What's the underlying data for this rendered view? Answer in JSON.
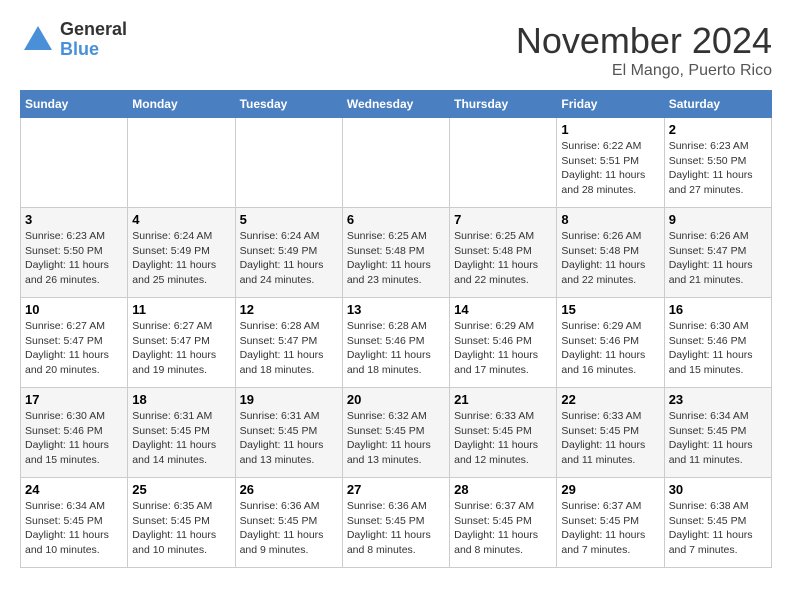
{
  "logo": {
    "general": "General",
    "blue": "Blue"
  },
  "title": {
    "month": "November 2024",
    "location": "El Mango, Puerto Rico"
  },
  "weekdays": [
    "Sunday",
    "Monday",
    "Tuesday",
    "Wednesday",
    "Thursday",
    "Friday",
    "Saturday"
  ],
  "weeks": [
    [
      {
        "day": "",
        "sunrise": "",
        "sunset": "",
        "daylight": ""
      },
      {
        "day": "",
        "sunrise": "",
        "sunset": "",
        "daylight": ""
      },
      {
        "day": "",
        "sunrise": "",
        "sunset": "",
        "daylight": ""
      },
      {
        "day": "",
        "sunrise": "",
        "sunset": "",
        "daylight": ""
      },
      {
        "day": "",
        "sunrise": "",
        "sunset": "",
        "daylight": ""
      },
      {
        "day": "1",
        "sunrise": "Sunrise: 6:22 AM",
        "sunset": "Sunset: 5:51 PM",
        "daylight": "Daylight: 11 hours and 28 minutes."
      },
      {
        "day": "2",
        "sunrise": "Sunrise: 6:23 AM",
        "sunset": "Sunset: 5:50 PM",
        "daylight": "Daylight: 11 hours and 27 minutes."
      }
    ],
    [
      {
        "day": "3",
        "sunrise": "Sunrise: 6:23 AM",
        "sunset": "Sunset: 5:50 PM",
        "daylight": "Daylight: 11 hours and 26 minutes."
      },
      {
        "day": "4",
        "sunrise": "Sunrise: 6:24 AM",
        "sunset": "Sunset: 5:49 PM",
        "daylight": "Daylight: 11 hours and 25 minutes."
      },
      {
        "day": "5",
        "sunrise": "Sunrise: 6:24 AM",
        "sunset": "Sunset: 5:49 PM",
        "daylight": "Daylight: 11 hours and 24 minutes."
      },
      {
        "day": "6",
        "sunrise": "Sunrise: 6:25 AM",
        "sunset": "Sunset: 5:48 PM",
        "daylight": "Daylight: 11 hours and 23 minutes."
      },
      {
        "day": "7",
        "sunrise": "Sunrise: 6:25 AM",
        "sunset": "Sunset: 5:48 PM",
        "daylight": "Daylight: 11 hours and 22 minutes."
      },
      {
        "day": "8",
        "sunrise": "Sunrise: 6:26 AM",
        "sunset": "Sunset: 5:48 PM",
        "daylight": "Daylight: 11 hours and 22 minutes."
      },
      {
        "day": "9",
        "sunrise": "Sunrise: 6:26 AM",
        "sunset": "Sunset: 5:47 PM",
        "daylight": "Daylight: 11 hours and 21 minutes."
      }
    ],
    [
      {
        "day": "10",
        "sunrise": "Sunrise: 6:27 AM",
        "sunset": "Sunset: 5:47 PM",
        "daylight": "Daylight: 11 hours and 20 minutes."
      },
      {
        "day": "11",
        "sunrise": "Sunrise: 6:27 AM",
        "sunset": "Sunset: 5:47 PM",
        "daylight": "Daylight: 11 hours and 19 minutes."
      },
      {
        "day": "12",
        "sunrise": "Sunrise: 6:28 AM",
        "sunset": "Sunset: 5:47 PM",
        "daylight": "Daylight: 11 hours and 18 minutes."
      },
      {
        "day": "13",
        "sunrise": "Sunrise: 6:28 AM",
        "sunset": "Sunset: 5:46 PM",
        "daylight": "Daylight: 11 hours and 18 minutes."
      },
      {
        "day": "14",
        "sunrise": "Sunrise: 6:29 AM",
        "sunset": "Sunset: 5:46 PM",
        "daylight": "Daylight: 11 hours and 17 minutes."
      },
      {
        "day": "15",
        "sunrise": "Sunrise: 6:29 AM",
        "sunset": "Sunset: 5:46 PM",
        "daylight": "Daylight: 11 hours and 16 minutes."
      },
      {
        "day": "16",
        "sunrise": "Sunrise: 6:30 AM",
        "sunset": "Sunset: 5:46 PM",
        "daylight": "Daylight: 11 hours and 15 minutes."
      }
    ],
    [
      {
        "day": "17",
        "sunrise": "Sunrise: 6:30 AM",
        "sunset": "Sunset: 5:46 PM",
        "daylight": "Daylight: 11 hours and 15 minutes."
      },
      {
        "day": "18",
        "sunrise": "Sunrise: 6:31 AM",
        "sunset": "Sunset: 5:45 PM",
        "daylight": "Daylight: 11 hours and 14 minutes."
      },
      {
        "day": "19",
        "sunrise": "Sunrise: 6:31 AM",
        "sunset": "Sunset: 5:45 PM",
        "daylight": "Daylight: 11 hours and 13 minutes."
      },
      {
        "day": "20",
        "sunrise": "Sunrise: 6:32 AM",
        "sunset": "Sunset: 5:45 PM",
        "daylight": "Daylight: 11 hours and 13 minutes."
      },
      {
        "day": "21",
        "sunrise": "Sunrise: 6:33 AM",
        "sunset": "Sunset: 5:45 PM",
        "daylight": "Daylight: 11 hours and 12 minutes."
      },
      {
        "day": "22",
        "sunrise": "Sunrise: 6:33 AM",
        "sunset": "Sunset: 5:45 PM",
        "daylight": "Daylight: 11 hours and 11 minutes."
      },
      {
        "day": "23",
        "sunrise": "Sunrise: 6:34 AM",
        "sunset": "Sunset: 5:45 PM",
        "daylight": "Daylight: 11 hours and 11 minutes."
      }
    ],
    [
      {
        "day": "24",
        "sunrise": "Sunrise: 6:34 AM",
        "sunset": "Sunset: 5:45 PM",
        "daylight": "Daylight: 11 hours and 10 minutes."
      },
      {
        "day": "25",
        "sunrise": "Sunrise: 6:35 AM",
        "sunset": "Sunset: 5:45 PM",
        "daylight": "Daylight: 11 hours and 10 minutes."
      },
      {
        "day": "26",
        "sunrise": "Sunrise: 6:36 AM",
        "sunset": "Sunset: 5:45 PM",
        "daylight": "Daylight: 11 hours and 9 minutes."
      },
      {
        "day": "27",
        "sunrise": "Sunrise: 6:36 AM",
        "sunset": "Sunset: 5:45 PM",
        "daylight": "Daylight: 11 hours and 8 minutes."
      },
      {
        "day": "28",
        "sunrise": "Sunrise: 6:37 AM",
        "sunset": "Sunset: 5:45 PM",
        "daylight": "Daylight: 11 hours and 8 minutes."
      },
      {
        "day": "29",
        "sunrise": "Sunrise: 6:37 AM",
        "sunset": "Sunset: 5:45 PM",
        "daylight": "Daylight: 11 hours and 7 minutes."
      },
      {
        "day": "30",
        "sunrise": "Sunrise: 6:38 AM",
        "sunset": "Sunset: 5:45 PM",
        "daylight": "Daylight: 11 hours and 7 minutes."
      }
    ]
  ]
}
